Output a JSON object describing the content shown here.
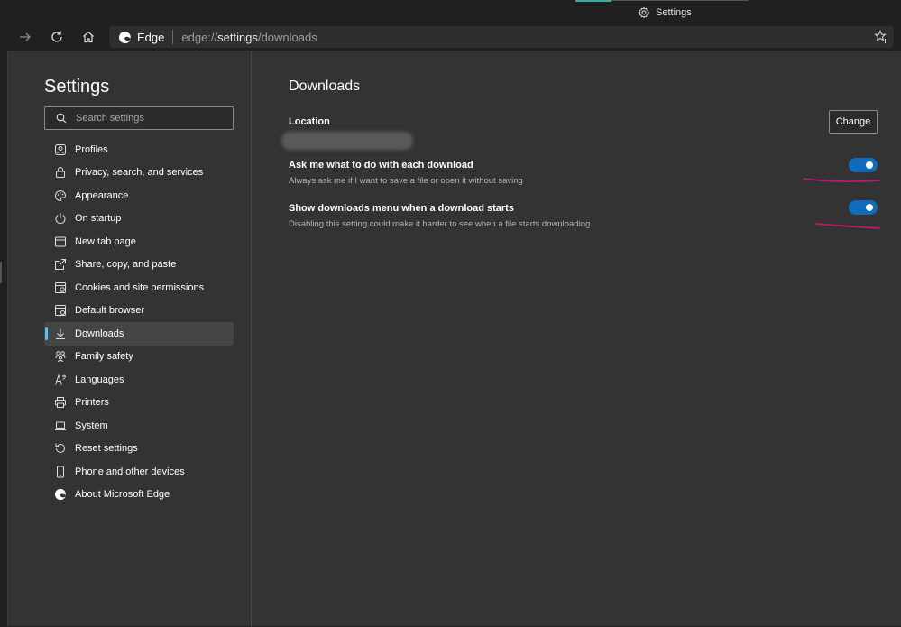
{
  "browser": {
    "tab_title": "Settings",
    "site_name": "Edge",
    "url_prefix": "edge://",
    "url_host": "settings",
    "url_path": "/downloads"
  },
  "sidebar": {
    "title": "Settings",
    "search_placeholder": "Search settings",
    "items": [
      {
        "label": "Profiles",
        "icon": "profile-icon"
      },
      {
        "label": "Privacy, search, and services",
        "icon": "lock-icon"
      },
      {
        "label": "Appearance",
        "icon": "palette-icon"
      },
      {
        "label": "On startup",
        "icon": "power-icon"
      },
      {
        "label": "New tab page",
        "icon": "new-tab-icon"
      },
      {
        "label": "Share, copy, and paste",
        "icon": "share-icon"
      },
      {
        "label": "Cookies and site permissions",
        "icon": "cookies-icon"
      },
      {
        "label": "Default browser",
        "icon": "default-browser-icon"
      },
      {
        "label": "Downloads",
        "icon": "download-icon",
        "active": true
      },
      {
        "label": "Family safety",
        "icon": "family-icon"
      },
      {
        "label": "Languages",
        "icon": "languages-icon"
      },
      {
        "label": "Printers",
        "icon": "printer-icon"
      },
      {
        "label": "System",
        "icon": "laptop-icon"
      },
      {
        "label": "Reset settings",
        "icon": "reset-icon"
      },
      {
        "label": "Phone and other devices",
        "icon": "phone-icon"
      },
      {
        "label": "About Microsoft Edge",
        "icon": "edge-logo-icon"
      }
    ]
  },
  "main": {
    "heading": "Downloads",
    "location_label": "Location",
    "change_label": "Change",
    "settings": [
      {
        "title": "Ask me what to do with each download",
        "description": "Always ask me if I want to save a file or open it without saving",
        "enabled": true
      },
      {
        "title": "Show downloads menu when a download starts",
        "description": "Disabling this setting could make it harder to see when a file starts downloading",
        "enabled": true
      }
    ]
  },
  "colors": {
    "accent": "#0f6cbd",
    "active_indicator": "#4cc2ff",
    "annotation": "#c2186b"
  }
}
